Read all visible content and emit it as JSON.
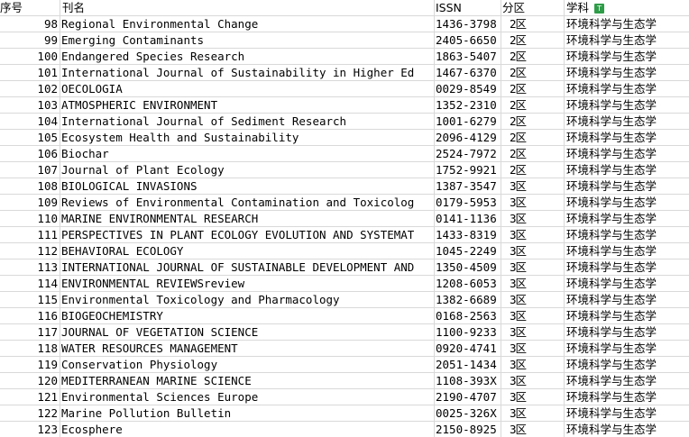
{
  "header": {
    "num": "序号",
    "name": "刊名",
    "issn": "ISSN",
    "zone": "分区",
    "subject": "学科",
    "filter_icon": "T"
  },
  "rows": [
    {
      "num": "98",
      "name": "Regional Environmental Change",
      "issn": "1436-3798",
      "zone": "2区",
      "subject": "环境科学与生态学"
    },
    {
      "num": "99",
      "name": "Emerging Contaminants",
      "issn": "2405-6650",
      "zone": "2区",
      "subject": "环境科学与生态学"
    },
    {
      "num": "100",
      "name": "Endangered Species Research",
      "issn": "1863-5407",
      "zone": "2区",
      "subject": "环境科学与生态学"
    },
    {
      "num": "101",
      "name": "International Journal of Sustainability in Higher Ed",
      "issn": "1467-6370",
      "zone": "2区",
      "subject": "环境科学与生态学"
    },
    {
      "num": "102",
      "name": "OECOLOGIA",
      "issn": "0029-8549",
      "zone": "2区",
      "subject": "环境科学与生态学"
    },
    {
      "num": "103",
      "name": "ATMOSPHERIC ENVIRONMENT",
      "issn": "1352-2310",
      "zone": "2区",
      "subject": "环境科学与生态学"
    },
    {
      "num": "104",
      "name": "International Journal of Sediment Research",
      "issn": "1001-6279",
      "zone": "2区",
      "subject": "环境科学与生态学"
    },
    {
      "num": "105",
      "name": "Ecosystem Health and Sustainability",
      "issn": "2096-4129",
      "zone": "2区",
      "subject": "环境科学与生态学"
    },
    {
      "num": "106",
      "name": "Biochar",
      "issn": "2524-7972",
      "zone": "2区",
      "subject": "环境科学与生态学"
    },
    {
      "num": "107",
      "name": "Journal of Plant Ecology",
      "issn": "1752-9921",
      "zone": "2区",
      "subject": "环境科学与生态学"
    },
    {
      "num": "108",
      "name": "BIOLOGICAL INVASIONS",
      "issn": "1387-3547",
      "zone": "3区",
      "subject": "环境科学与生态学"
    },
    {
      "num": "109",
      "name": "Reviews of Environmental Contamination and Toxicolog",
      "issn": "0179-5953",
      "zone": "3区",
      "subject": "环境科学与生态学"
    },
    {
      "num": "110",
      "name": "MARINE ENVIRONMENTAL RESEARCH",
      "issn": "0141-1136",
      "zone": "3区",
      "subject": "环境科学与生态学"
    },
    {
      "num": "111",
      "name": "PERSPECTIVES IN PLANT ECOLOGY EVOLUTION AND SYSTEMAT",
      "issn": "1433-8319",
      "zone": "3区",
      "subject": "环境科学与生态学"
    },
    {
      "num": "112",
      "name": "BEHAVIORAL ECOLOGY",
      "issn": "1045-2249",
      "zone": "3区",
      "subject": "环境科学与生态学"
    },
    {
      "num": "113",
      "name": "INTERNATIONAL JOURNAL OF SUSTAINABLE DEVELOPMENT AND",
      "issn": "1350-4509",
      "zone": "3区",
      "subject": "环境科学与生态学"
    },
    {
      "num": "114",
      "name": "ENVIRONMENTAL REVIEWSreview",
      "issn": "1208-6053",
      "zone": "3区",
      "subject": "环境科学与生态学"
    },
    {
      "num": "115",
      "name": "Environmental Toxicology and Pharmacology",
      "issn": "1382-6689",
      "zone": "3区",
      "subject": "环境科学与生态学"
    },
    {
      "num": "116",
      "name": "BIOGEOCHEMISTRY",
      "issn": "0168-2563",
      "zone": "3区",
      "subject": "环境科学与生态学"
    },
    {
      "num": "117",
      "name": "JOURNAL OF VEGETATION SCIENCE",
      "issn": "1100-9233",
      "zone": "3区",
      "subject": "环境科学与生态学"
    },
    {
      "num": "118",
      "name": "WATER RESOURCES MANAGEMENT",
      "issn": "0920-4741",
      "zone": "3区",
      "subject": "环境科学与生态学"
    },
    {
      "num": "119",
      "name": "Conservation Physiology",
      "issn": "2051-1434",
      "zone": "3区",
      "subject": "环境科学与生态学"
    },
    {
      "num": "120",
      "name": "MEDITERRANEAN MARINE SCIENCE",
      "issn": "1108-393X",
      "zone": "3区",
      "subject": "环境科学与生态学"
    },
    {
      "num": "121",
      "name": "Environmental Sciences Europe",
      "issn": "2190-4707",
      "zone": "3区",
      "subject": "环境科学与生态学"
    },
    {
      "num": "122",
      "name": "Marine Pollution Bulletin",
      "issn": "0025-326X",
      "zone": "3区",
      "subject": "环境科学与生态学"
    },
    {
      "num": "123",
      "name": "Ecosphere",
      "issn": "2150-8925",
      "zone": "3区",
      "subject": "环境科学与生态学"
    }
  ]
}
